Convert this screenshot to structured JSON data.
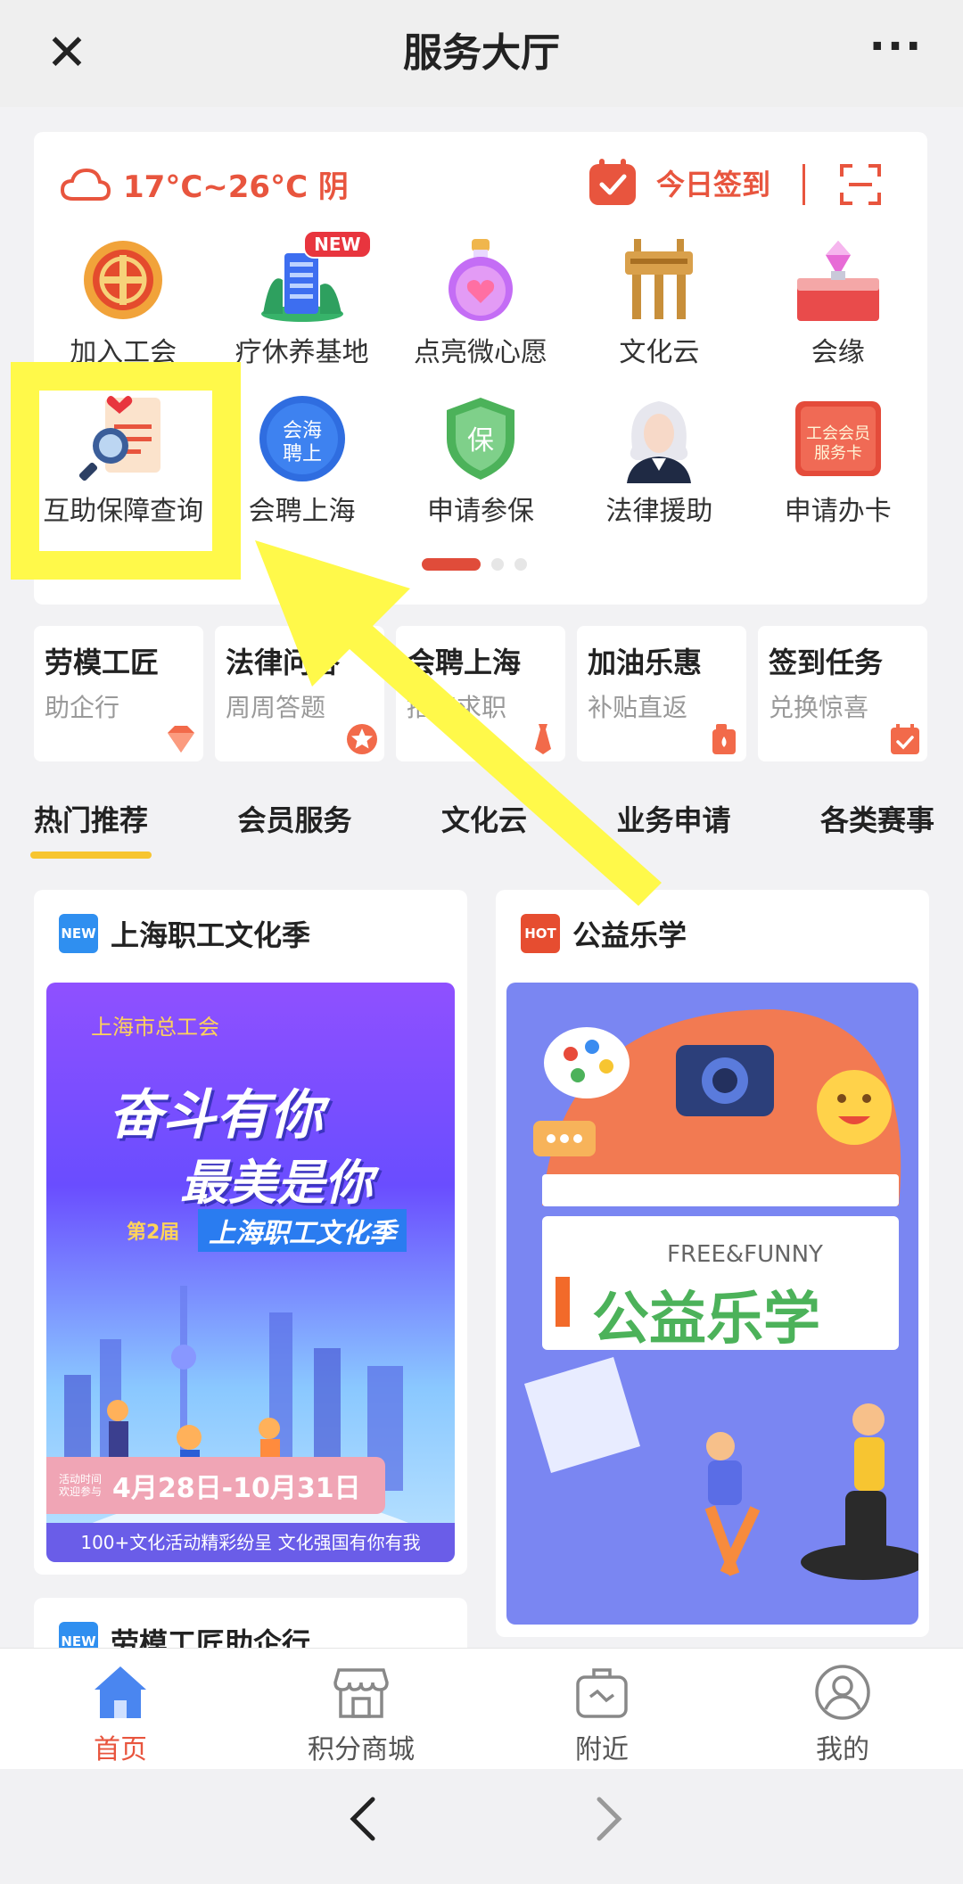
{
  "header": {
    "title": "服务大厅",
    "close_icon": "close-icon",
    "more_icon": "more-icon"
  },
  "weather": {
    "text": "17°C~26°C 阴",
    "icon": "cloud-icon"
  },
  "signin": {
    "label": "今日签到",
    "icon": "calendar-check-icon"
  },
  "scan": {
    "icon": "scan-icon"
  },
  "grid": {
    "row1": [
      {
        "label": "加入工会",
        "icon": "union-badge-icon"
      },
      {
        "label": "疗休养基地",
        "icon": "resort-building-icon",
        "badge": "NEW"
      },
      {
        "label": "点亮微心愿",
        "icon": "wish-bottle-icon"
      },
      {
        "label": "文化云",
        "icon": "bronze-ding-icon"
      },
      {
        "label": "会缘",
        "icon": "gift-ring-icon"
      }
    ],
    "row2": [
      {
        "label": "互助保障查询",
        "icon": "document-search-icon"
      },
      {
        "label": "会聘上海",
        "icon": "recruit-badge-icon"
      },
      {
        "label": "申请参保",
        "icon": "insurance-shield-icon"
      },
      {
        "label": "法律援助",
        "icon": "lawyer-icon"
      },
      {
        "label": "申请办卡",
        "icon": "member-card-icon",
        "card_text": "工会会员服务卡"
      }
    ]
  },
  "quick": [
    {
      "title": "劳模工匠",
      "sub": "助企行",
      "icon": "diamond-icon"
    },
    {
      "title": "法律问答",
      "sub": "周周答题",
      "icon": "star-icon"
    },
    {
      "title": "会聘上海",
      "sub": "招聘求职",
      "icon": "tie-icon"
    },
    {
      "title": "加油乐惠",
      "sub": "补贴直返",
      "icon": "fuel-icon"
    },
    {
      "title": "签到任务",
      "sub": "兑换惊喜",
      "icon": "calendar-icon"
    }
  ],
  "tabs": [
    "热门推荐",
    "会员服务",
    "文化云",
    "业务申请",
    "各类赛事"
  ],
  "feed": [
    {
      "tag": "NEW",
      "title": "上海职工文化季",
      "poster": {
        "org": "上海市总工会",
        "line1": "奋斗有你",
        "line2": "最美是你",
        "edition": "第2届",
        "subtitle": "上海职工文化季",
        "date_label": "活动时间 欢迎参与",
        "date": "4月28日-10月31日",
        "footer": "100+文化活动精彩纷呈 文化强国有你有我"
      }
    },
    {
      "tag": "HOT",
      "title": "公益乐学",
      "poster": {
        "en": "FREE&FUNNY",
        "cn": "公益乐学"
      }
    },
    {
      "tag": "NEW",
      "title": "劳模工匠助企行"
    }
  ],
  "bottom_nav": [
    {
      "label": "首页",
      "icon": "home-icon",
      "active": true
    },
    {
      "label": "积分商城",
      "icon": "store-icon"
    },
    {
      "label": "附近",
      "icon": "toolbox-icon"
    },
    {
      "label": "我的",
      "icon": "user-icon"
    }
  ],
  "browser": {
    "back_icon": "chevron-left-icon",
    "forward_icon": "chevron-right-icon"
  },
  "colors": {
    "accent": "#e8553e",
    "highlight": "#fff94a",
    "tab_underline": "#f7c531"
  }
}
